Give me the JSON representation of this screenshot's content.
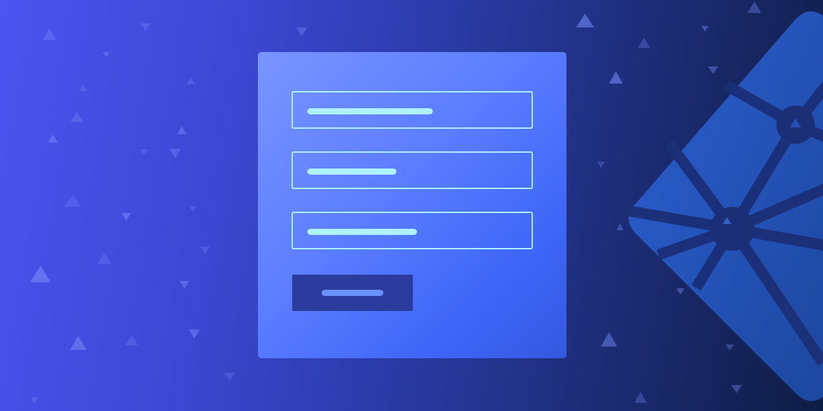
{
  "colors": {
    "background_start": "#4a55f0",
    "background_end": "#0e1d44",
    "card_start": "#7a95ff",
    "card_end": "#3558e0",
    "field_border": "#aef2ff",
    "placeholder_bar": "#aef2ff",
    "submit_button": "#2c3c9e",
    "submit_bar": "#6a92ff",
    "logo_fill": "#2d63d6",
    "logo_lines": "#1a2f78",
    "triangles": "#6c86ff"
  },
  "form": {
    "fields": [
      {
        "placeholder_fill": 0.52
      },
      {
        "placeholder_fill": 0.37
      },
      {
        "placeholder_fill": 0.455
      }
    ]
  },
  "icons": {
    "logo": "netlify-logo-icon",
    "decor": "triangle-icon"
  }
}
